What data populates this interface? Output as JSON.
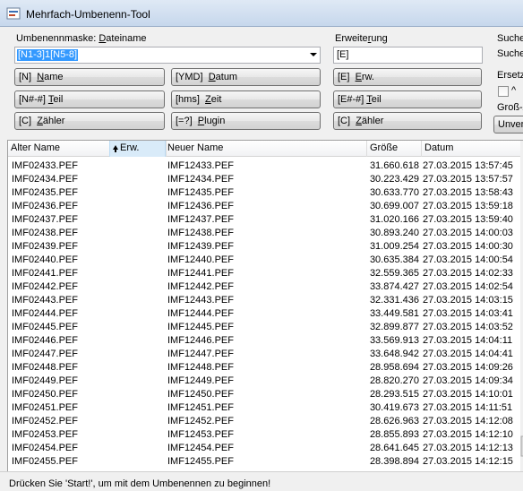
{
  "window": {
    "title": "Mehrfach-Umbenenn-Tool"
  },
  "mask": {
    "label_prefix": "Umbenennmaske: ",
    "label_underlined": "D",
    "label_suffix": "ateiname",
    "value": "[N1-3]1[N5-8]"
  },
  "extension": {
    "label_prefix": "Erweite",
    "label_underlined": "r",
    "label_suffix": "ung",
    "value": "[E]"
  },
  "buttons": {
    "name": {
      "token": "[N]",
      "u": "N",
      "rest": "ame"
    },
    "datum": {
      "token": "[YMD]",
      "u": "D",
      "rest": "atum"
    },
    "erw": {
      "token": "[E]",
      "u": "E",
      "rest": "rw."
    },
    "teil": {
      "token": "[N#-#]",
      "u": "T",
      "rest": "eil"
    },
    "zeit": {
      "token": "[hms]",
      "u": "Z",
      "rest": "eit"
    },
    "erwteil": {
      "token": "[E#-#]",
      "u": "T",
      "rest": "eil"
    },
    "zaehler": {
      "token": "[C]",
      "u": "Z",
      "rest": "ähler"
    },
    "plugin": {
      "token": "[=?]",
      "u": "P",
      "rest": "lugin"
    },
    "erwzaehler": {
      "token": "[C]",
      "u": "Z",
      "rest": "ähler"
    }
  },
  "search": {
    "header": "Suche",
    "field": "Suche",
    "replace": "Ersetz",
    "check_label": "^",
    "case_label": "Groß-/",
    "button": "Unver"
  },
  "table": {
    "columns": {
      "old": "Alter Name",
      "ext": "Erw.",
      "new": "Neuer Name",
      "size": "Größe",
      "date": "Datum"
    },
    "rows": [
      {
        "old": "IMF02433.PEF",
        "new": "IMF12433.PEF",
        "size": "31.660.618",
        "date": "27.03.2015 13:57:45"
      },
      {
        "old": "IMF02434.PEF",
        "new": "IMF12434.PEF",
        "size": "30.223.429",
        "date": "27.03.2015 13:57:57"
      },
      {
        "old": "IMF02435.PEF",
        "new": "IMF12435.PEF",
        "size": "30.633.770",
        "date": "27.03.2015 13:58:43"
      },
      {
        "old": "IMF02436.PEF",
        "new": "IMF12436.PEF",
        "size": "30.699.007",
        "date": "27.03.2015 13:59:18"
      },
      {
        "old": "IMF02437.PEF",
        "new": "IMF12437.PEF",
        "size": "31.020.166",
        "date": "27.03.2015 13:59:40"
      },
      {
        "old": "IMF02438.PEF",
        "new": "IMF12438.PEF",
        "size": "30.893.240",
        "date": "27.03.2015 14:00:03"
      },
      {
        "old": "IMF02439.PEF",
        "new": "IMF12439.PEF",
        "size": "31.009.254",
        "date": "27.03.2015 14:00:30"
      },
      {
        "old": "IMF02440.PEF",
        "new": "IMF12440.PEF",
        "size": "30.635.384",
        "date": "27.03.2015 14:00:54"
      },
      {
        "old": "IMF02441.PEF",
        "new": "IMF12441.PEF",
        "size": "32.559.365",
        "date": "27.03.2015 14:02:33"
      },
      {
        "old": "IMF02442.PEF",
        "new": "IMF12442.PEF",
        "size": "33.874.427",
        "date": "27.03.2015 14:02:54"
      },
      {
        "old": "IMF02443.PEF",
        "new": "IMF12443.PEF",
        "size": "32.331.436",
        "date": "27.03.2015 14:03:15"
      },
      {
        "old": "IMF02444.PEF",
        "new": "IMF12444.PEF",
        "size": "33.449.581",
        "date": "27.03.2015 14:03:41"
      },
      {
        "old": "IMF02445.PEF",
        "new": "IMF12445.PEF",
        "size": "32.899.877",
        "date": "27.03.2015 14:03:52"
      },
      {
        "old": "IMF02446.PEF",
        "new": "IMF12446.PEF",
        "size": "33.569.913",
        "date": "27.03.2015 14:04:11"
      },
      {
        "old": "IMF02447.PEF",
        "new": "IMF12447.PEF",
        "size": "33.648.942",
        "date": "27.03.2015 14:04:41"
      },
      {
        "old": "IMF02448.PEF",
        "new": "IMF12448.PEF",
        "size": "28.958.694",
        "date": "27.03.2015 14:09:26"
      },
      {
        "old": "IMF02449.PEF",
        "new": "IMF12449.PEF",
        "size": "28.820.270",
        "date": "27.03.2015 14:09:34"
      },
      {
        "old": "IMF02450.PEF",
        "new": "IMF12450.PEF",
        "size": "28.293.515",
        "date": "27.03.2015 14:10:01"
      },
      {
        "old": "IMF02451.PEF",
        "new": "IMF12451.PEF",
        "size": "30.419.673",
        "date": "27.03.2015 14:11:51"
      },
      {
        "old": "IMF02452.PEF",
        "new": "IMF12452.PEF",
        "size": "28.626.963",
        "date": "27.03.2015 14:12:08"
      },
      {
        "old": "IMF02453.PEF",
        "new": "IMF12453.PEF",
        "size": "28.855.893",
        "date": "27.03.2015 14:12:10"
      },
      {
        "old": "IMF02454.PEF",
        "new": "IMF12454.PEF",
        "size": "28.641.645",
        "date": "27.03.2015 14:12:13"
      },
      {
        "old": "IMF02455.PEF",
        "new": "IMF12455.PEF",
        "size": "28.398.894",
        "date": "27.03.2015 14:12:15"
      }
    ]
  },
  "status": {
    "text": "Drücken Sie 'Start!', um mit dem Umbenennen zu beginnen!"
  }
}
